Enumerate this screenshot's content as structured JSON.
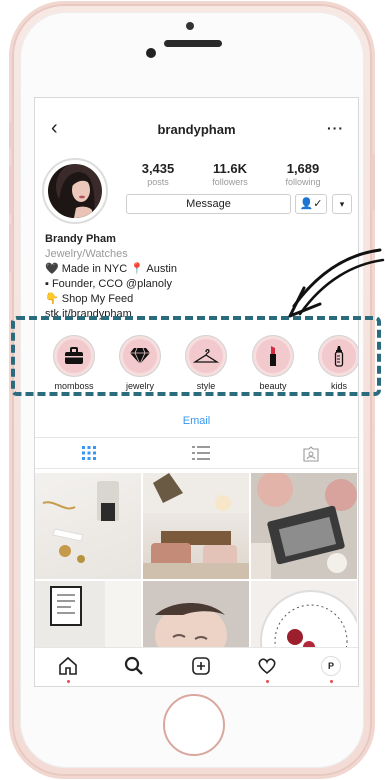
{
  "profile": {
    "username": "brandypham",
    "back_glyph": "‹",
    "more_glyph": "···",
    "name": "Brandy Pham",
    "category": "Jewelry/Watches",
    "bio_lines": [
      "🖤 Made in NYC 📍 Austin",
      "▪ Founder, CCO @planoly",
      "👇 Shop My Feed",
      "stk.it/brandypham"
    ]
  },
  "stats": [
    {
      "value": "3,435",
      "label": "posts"
    },
    {
      "value": "11.6K",
      "label": "followers"
    },
    {
      "value": "1,689",
      "label": "following"
    }
  ],
  "buttons": {
    "message": "Message",
    "follow_glyph": "👤✓",
    "dropdown_glyph": "▾",
    "email": "Email"
  },
  "highlights": [
    {
      "label": "momboss",
      "icon": "briefcase-icon"
    },
    {
      "label": "jewelry",
      "icon": "diamond-icon"
    },
    {
      "label": "style",
      "icon": "hanger-icon"
    },
    {
      "label": "beauty",
      "icon": "lipstick-icon"
    },
    {
      "label": "kids",
      "icon": "baby-bottle-icon"
    }
  ],
  "tabs": [
    "grid-icon",
    "list-icon",
    "tagged-icon"
  ],
  "nav": [
    "home-icon",
    "search-icon",
    "add-post-icon",
    "heart-icon",
    "profile-icon"
  ],
  "nav_profile_letter": "P",
  "colors": {
    "accent_blue": "#3897f0",
    "highlight_fill": "#f2c9cc",
    "dashed_outline": "#2a6b7e",
    "phone_shell": "#f3dcd6",
    "notification_dot": "#ed4956"
  }
}
